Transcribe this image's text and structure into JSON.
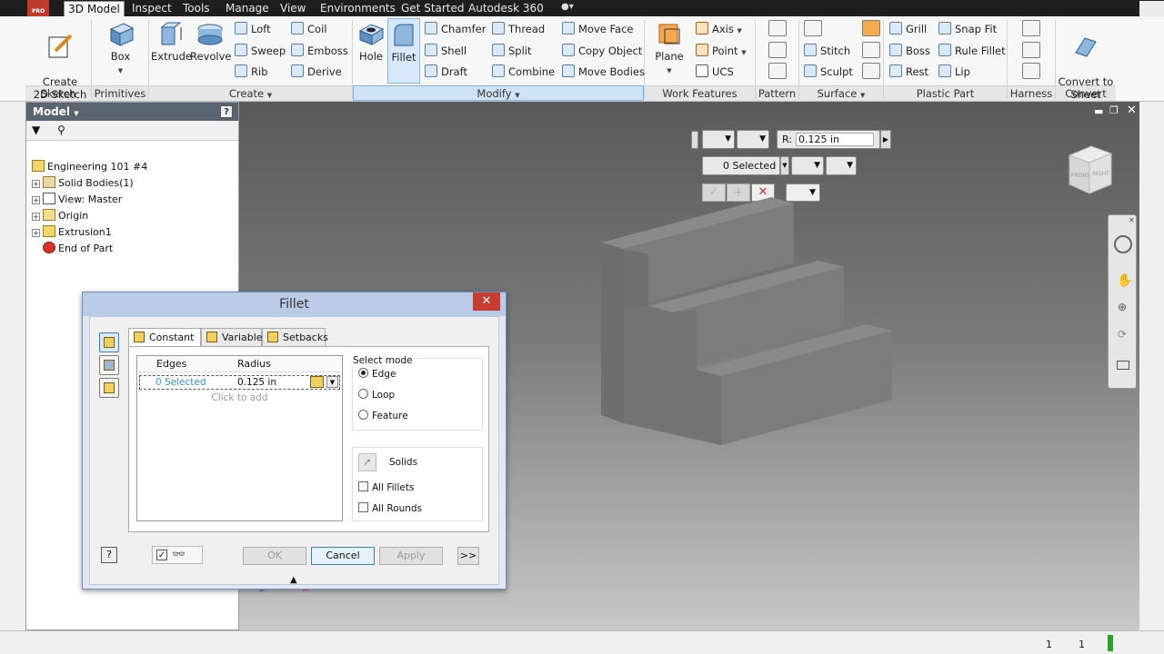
{
  "menubar": {
    "logo": "PRO",
    "tabs": [
      "3D Model",
      "Inspect",
      "Tools",
      "Manage",
      "View",
      "Environments",
      "Get Started",
      "Autodesk 360"
    ]
  },
  "ribbon": {
    "groups": [
      "Sketch",
      "Primitives",
      "Create",
      "Modify",
      "Work Features",
      "Pattern",
      "Surface",
      "Plastic Part",
      "Harness",
      "Convert"
    ],
    "sketch": {
      "create_2d_sketch": "Create\n2D Sketch"
    },
    "primitives": {
      "box": "Box"
    },
    "create": {
      "extrude": "Extrude",
      "revolve": "Revolve",
      "loft": "Loft",
      "sweep": "Sweep",
      "rib": "Rib",
      "coil": "Coil",
      "emboss": "Emboss",
      "derive": "Derive"
    },
    "modify": {
      "hole": "Hole",
      "fillet": "Fillet",
      "chamfer": "Chamfer",
      "shell": "Shell",
      "draft": "Draft",
      "thread": "Thread",
      "split": "Split",
      "combine": "Combine",
      "move_face": "Move Face",
      "copy_object": "Copy Object",
      "move_bodies": "Move Bodies"
    },
    "work_features": {
      "plane": "Plane",
      "axis": "Axis",
      "point": "Point",
      "ucs": "UCS"
    },
    "surface": {
      "stitch": "Stitch",
      "sculpt": "Sculpt"
    },
    "plastic_part": {
      "grill": "Grill",
      "boss": "Boss",
      "rest": "Rest",
      "snap_fit": "Snap Fit",
      "rule_fillet": "Rule Fillet",
      "lip": "Lip"
    },
    "convert": {
      "convert_to_sheet_metal": "Convert to\nSheet Metal"
    }
  },
  "browser": {
    "title": "Model",
    "help": "?",
    "tree": [
      {
        "label": "Engineering 101 #4",
        "indent": 0,
        "expander": false
      },
      {
        "label": "Solid Bodies(1)",
        "indent": 1,
        "expander": true
      },
      {
        "label": "View: Master",
        "indent": 1,
        "expander": true
      },
      {
        "label": "Origin",
        "indent": 1,
        "expander": true
      },
      {
        "label": "Extrusion1",
        "indent": 1,
        "expander": true
      },
      {
        "label": "End of Part",
        "indent": 1,
        "expander": false
      }
    ]
  },
  "minitoolbar": {
    "radius_label": "R:",
    "radius_value": "0.125 in",
    "selected": "0 Selected"
  },
  "viewcube": {
    "front": "FRONT",
    "right": "RIGHT"
  },
  "dialog": {
    "title": "Fillet",
    "close": "✕",
    "tabs": [
      "Constant",
      "Variable",
      "Setbacks"
    ],
    "table": {
      "headers": [
        "Edges",
        "Radius"
      ],
      "row": {
        "edges": "0 Selected",
        "radius": "0.125 in"
      },
      "click_to_add": "Click to add"
    },
    "select_mode": {
      "label": "Select mode",
      "options": [
        "Edge",
        "Loop",
        "Feature"
      ],
      "selected": "Edge"
    },
    "solids_label": "Solids",
    "all_fillets": "All Fillets",
    "all_rounds": "All Rounds",
    "buttons": {
      "ok": "OK",
      "cancel": "Cancel",
      "apply": "Apply",
      "more": ">>"
    },
    "help": "?"
  },
  "status": {
    "left_count": "1",
    "right_count": "1"
  },
  "colors": {
    "accent": "#3c7fb1",
    "close_red": "#c83d32",
    "viewport_top": "#5a5a5a",
    "viewport_bottom": "#c8c8c8"
  }
}
